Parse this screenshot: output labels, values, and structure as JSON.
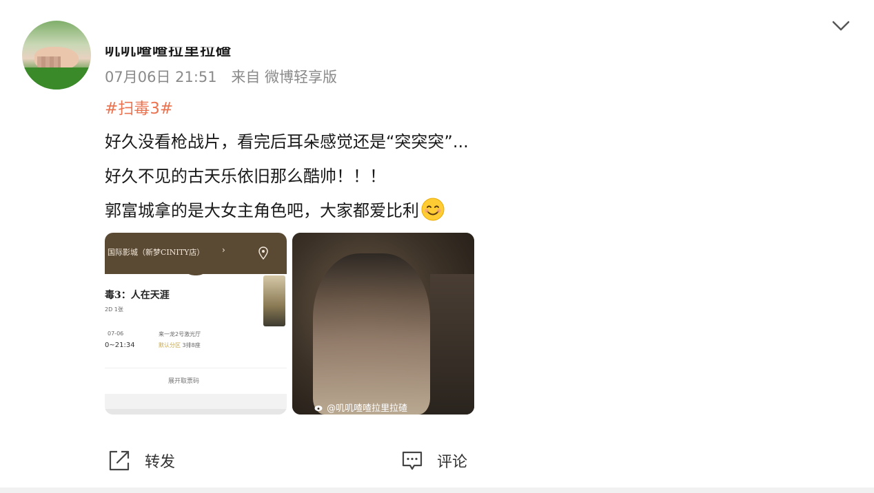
{
  "post": {
    "username": "叽叽喳喳拉里拉碴",
    "timestamp": "07月06日 21:51",
    "source": "来自 微博轻享版",
    "hashtag": "#扫毒3#",
    "lines": [
      "好久没看枪战片，看完后耳朵感觉还是“突突突”...",
      "好久不见的古天乐依旧那么酷帅！！！",
      "郭富城拿的是大女主角色吧，大家都爱比利"
    ],
    "emoji": "smile-emoji",
    "images": {
      "ticket": {
        "cinema": "国际影城（新梦CINITY店）",
        "movie": "毒3：人在天涯",
        "format": "2D 1张",
        "date": "07-06",
        "time": "0~21:34",
        "hall": "来一龙2号激光厅",
        "seat": "3排8座",
        "seat_prefix": "默认分区",
        "expand": "展开取票码"
      },
      "photo": {
        "watermark": "@叽叽喳喳拉里拉碴"
      }
    }
  },
  "actions": {
    "repost": "转发",
    "comment": "评论"
  },
  "colors": {
    "hashtag": "#eb7350",
    "meta": "#8a8a8a"
  }
}
